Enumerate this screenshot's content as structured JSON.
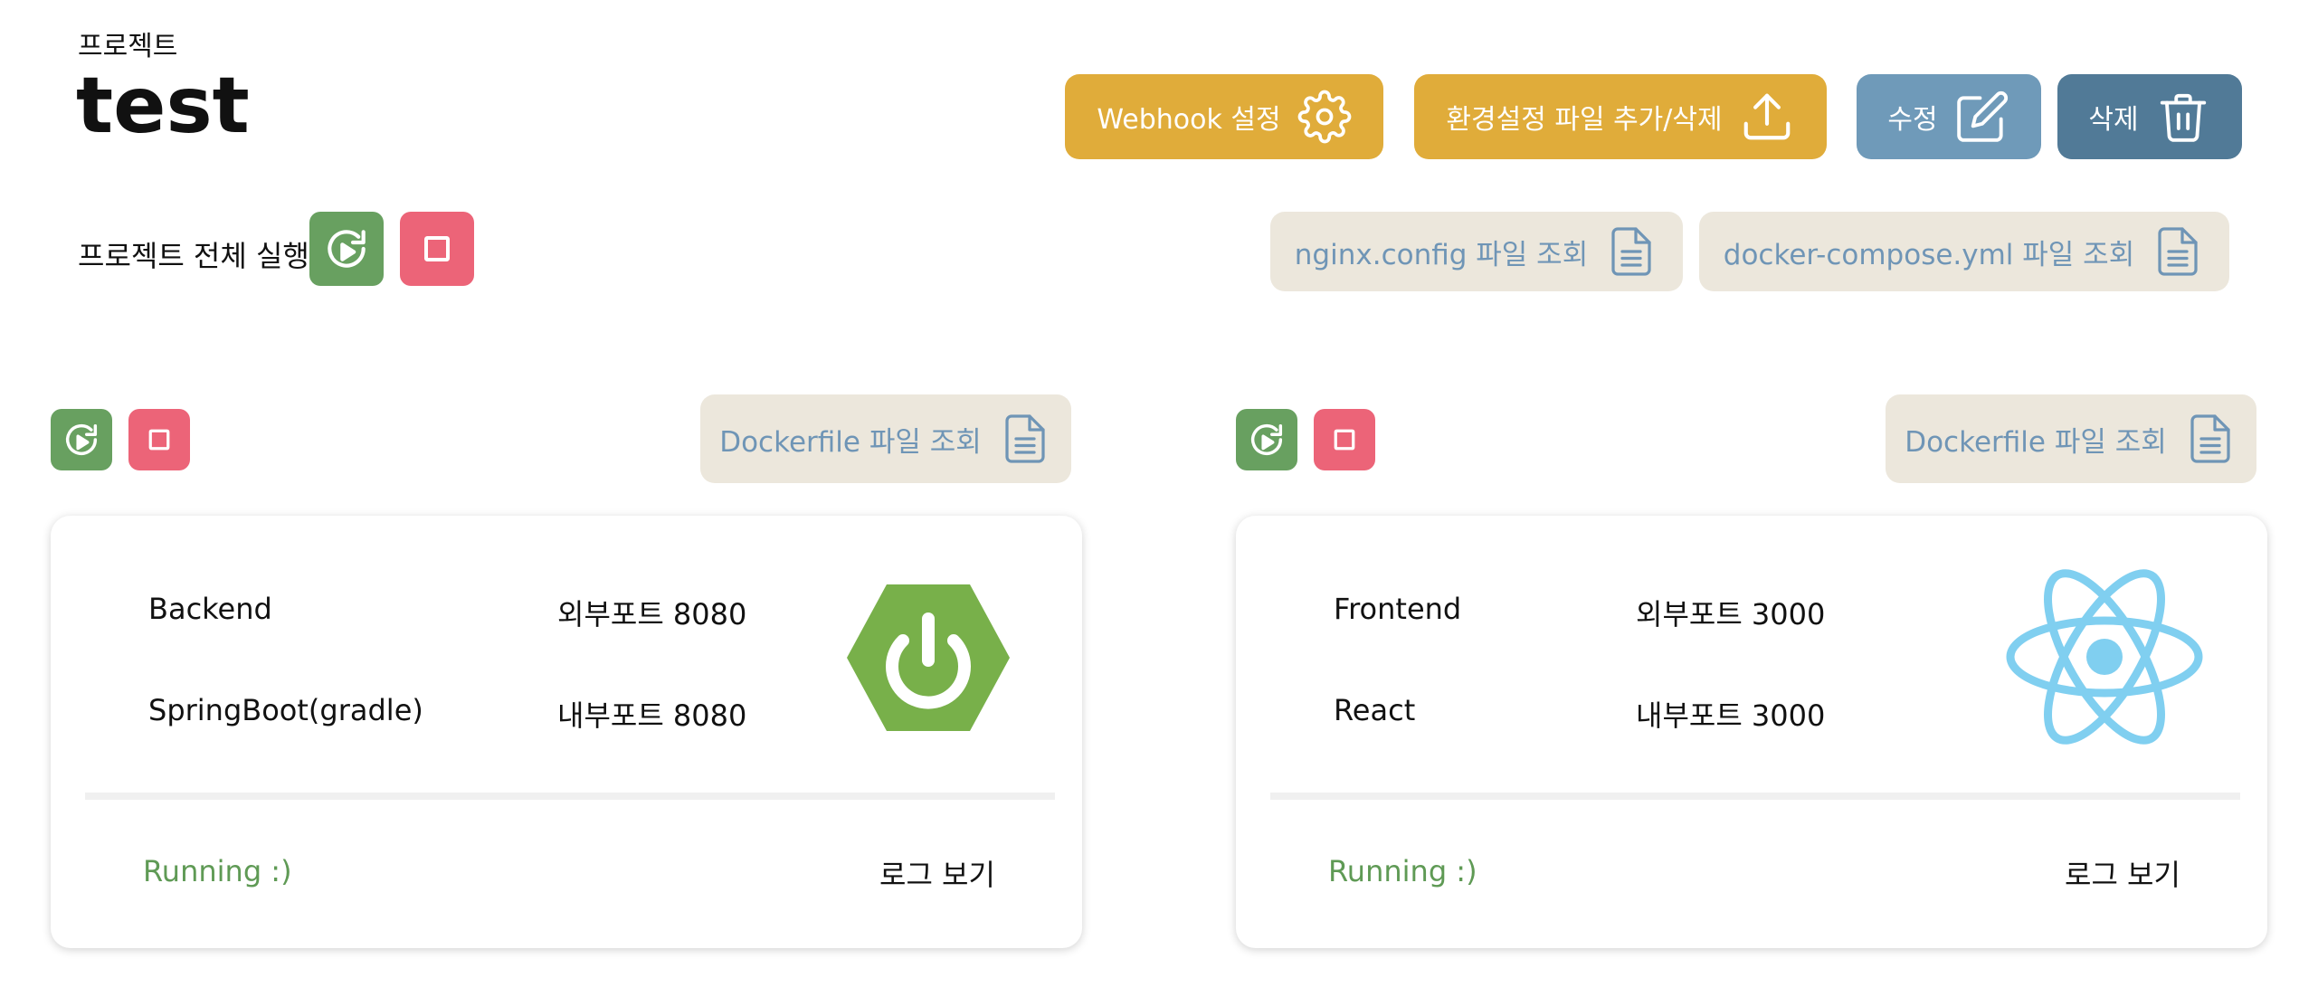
{
  "header": {
    "breadcrumb": "프로젝트",
    "title": "test"
  },
  "toolbar": {
    "webhook_label": "Webhook 설정",
    "env_label": "환경설정 파일 추가/삭제",
    "edit_label": "수정",
    "delete_label": "삭제"
  },
  "project_run": {
    "label": "프로젝트 전체 실행"
  },
  "files": {
    "nginx_label": "nginx.config 파일 조회",
    "compose_label": "docker-compose.yml 파일 조회"
  },
  "services": [
    {
      "dockerfile_label": "Dockerfile 파일 조회",
      "name": "Backend",
      "framework": "SpringBoot(gradle)",
      "external_port": "외부포트 8080",
      "internal_port": "내부포트 8080",
      "status": "Running :)",
      "log_label": "로그 보기",
      "logo_icon": "spring-boot-logo",
      "logo_color": "#78b04a"
    },
    {
      "dockerfile_label": "Dockerfile 파일 조회",
      "name": "Frontend",
      "framework": "React",
      "external_port": "외부포트 3000",
      "internal_port": "내부포트 3000",
      "status": "Running :)",
      "log_label": "로그 보기",
      "logo_icon": "react-logo",
      "logo_color": "#80cff0"
    }
  ],
  "colors": {
    "yellow": "#e0ac3a",
    "blue": "#6f9ab9",
    "navy": "#517a97",
    "green": "#68a060",
    "pink": "#ec6478",
    "beige": "#ece7dc",
    "running": "#5f9a55"
  }
}
